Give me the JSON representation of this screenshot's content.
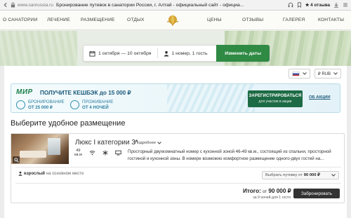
{
  "browser": {
    "url": "www.sanrussia.ru",
    "title": "Бронирование путевок в санатории России, г. Алтай - официальный сайт - официа...",
    "reviews": "4 отзыва"
  },
  "nav": {
    "items": [
      "О САНАТОРИИ",
      "ЛЕЧЕНИЕ",
      "РАЗМЕЩЕНИЕ",
      "ОТДЫХ",
      "ЦЕНЫ",
      "ОТЗЫВЫ",
      "ГАЛЕРЕЯ",
      "КОНТАКТЫ"
    ]
  },
  "booking": {
    "dates": "1 октября — 10 октября",
    "guests": "1 номер, 1 гость",
    "change_button": "Изменить даты"
  },
  "selectors": {
    "currency": "₽ RUB"
  },
  "promo": {
    "brand": "МИР",
    "headline": "ПОЛУЧИТЕ КЕШБЭК до 15 000 ₽",
    "perk1_line1": "БРОНИРОВАНИЕ",
    "perk1_line2": "ОТ 25 000 ₽",
    "perk2_line1": "ПРОЖИВАНИЕ",
    "perk2_line2": "ОТ 4 НОЧЕЙ",
    "register_line1": "ЗАРЕГИСТРИРОВАТЬСЯ",
    "register_line2": "для участия в акции",
    "about": "ОБ АКЦИИ"
  },
  "section_title": "Выберите удобное размещение",
  "room": {
    "name": "Люкс I категории 3*",
    "more": "Подробнее",
    "area_value": "49",
    "area_unit": "кв.м",
    "description": "Просторный двухкомнатный номер с кухонной зоной 46-49 кв.м., состоящий из спальни, просторной гостиной и кухонной зоны. В номере возможно комфортное размещение одного-двух гостей на...",
    "guest_type": "взрослый",
    "guest_place": "на основном месте",
    "pick_label": "Выбрать путевку от",
    "pick_price": "90 000 ₽",
    "total_label": "Итого:",
    "total_from": "от",
    "total_price": "90 000 ₽",
    "total_sub": "за 9 ночей для 1 гостя",
    "book_button": "Забронировать"
  },
  "colors": {
    "accent_green": "#2f8a43",
    "promo_green": "#1d6b45",
    "promo_text": "#1d5a7a"
  }
}
